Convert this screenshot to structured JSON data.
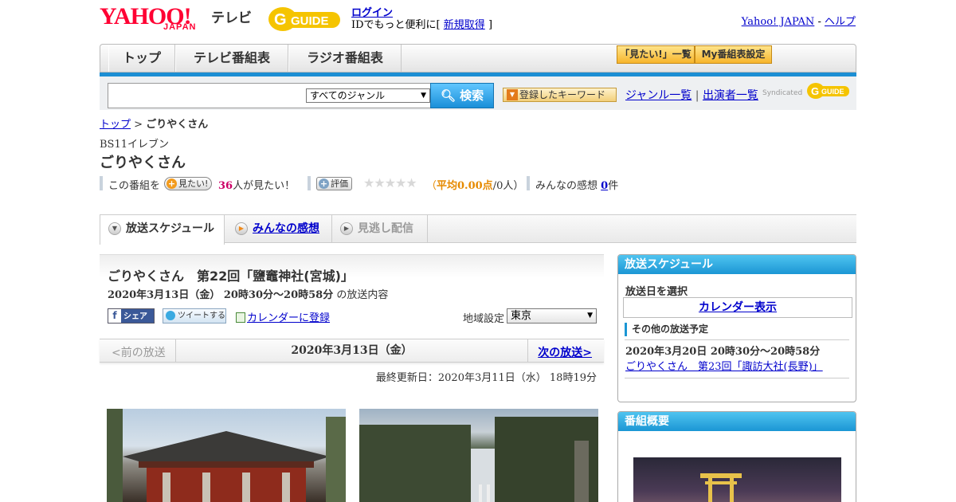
{
  "header": {
    "logo_yahoo": "YAHOO!",
    "logo_japan": "JAPAN",
    "logo_tv": "テレビ",
    "gguide_logo": "G-GUIDE",
    "login_link": "ログイン",
    "login_note_prefix": "IDでもっと便利に[",
    "signup_link": "新規取得",
    "login_note_suffix": "]",
    "yahoo_japan_link": "Yahoo! JAPAN",
    "separator": "-",
    "help_link": "ヘルプ"
  },
  "nav": {
    "tabs": [
      "トップ",
      "テレビ番組表",
      "ラジオ番組表"
    ],
    "want_list_button": "「見たい!」一覧",
    "my_guide_button": "My番組表設定"
  },
  "search": {
    "input_value": "",
    "genre_selected": "すべてのジャンル",
    "search_button": "検索",
    "keyword_button": "登録したキーワード",
    "genre_list_link": "ジャンル一覧",
    "divider": "|",
    "performer_list_link": "出演者一覧",
    "syndicated": "Syndicated"
  },
  "breadcrumb": {
    "top_link": "トップ",
    "sep": ">",
    "current": "ごりやくさん"
  },
  "program": {
    "station": "BS11イレブン",
    "title": "ごりやくさん",
    "this_program": "この番組を",
    "want_button": "見たい!",
    "want_count": "36",
    "want_suffix": "人が見たい！",
    "rate_button": "評価",
    "stars": "★★★★★",
    "avg_prefix": "（",
    "avg_label": "平均0.00点",
    "avg_suffix": "/0人）",
    "impressions_label": "みんなの感想",
    "impressions_count": "0",
    "impressions_unit": "件"
  },
  "tabs": {
    "schedule": "放送スケジュール",
    "impressions": "みんなの感想",
    "catchup": "見逃し配信"
  },
  "episode": {
    "title": "ごりやくさん　第22回「鹽竈神社(宮城)」",
    "datetime": "2020年3月13日（金）  20時30分～20時58分",
    "content_suffix": "の放送内容",
    "facebook_share": "シェア",
    "tweet": "ツイートする",
    "calendar_link": "カレンダーに登録",
    "region_label": "地域設定",
    "region_value": "東京"
  },
  "pager": {
    "prev": "<前の放送",
    "date": "2020年3月13日（金）",
    "next": "次の放送>"
  },
  "updated": "最終更新日：2020年3月11日（水）  18時19分",
  "sidebar": {
    "schedule_head": "放送スケジュール",
    "select_date": "放送日を選択",
    "calendar_button": "カレンダー表示",
    "other_label": "その他の放送予定",
    "other_date": "2020年3月20日  20時30分～20時58分",
    "other_link": "ごりやくさん　第23回「諏訪大社(長野)」",
    "overview_head": "番組概要"
  },
  "colors": {
    "accent_blue": "#1c8fd4",
    "brand_red": "#ff0033",
    "gguide_yellow": "#f5c400",
    "want_pink": "#cc0066",
    "avg_orange": "#e68a00"
  },
  "icons": [
    "search-icon",
    "plus-icon",
    "star-icon",
    "facebook-icon",
    "twitter-icon",
    "calendar-icon",
    "chevron-down-icon",
    "play-icon"
  ]
}
